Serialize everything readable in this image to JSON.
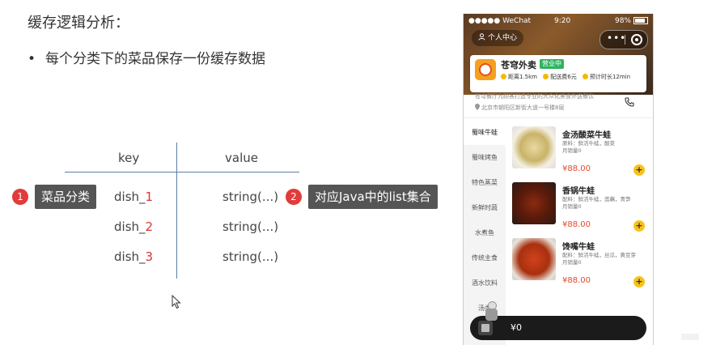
{
  "slide": {
    "title": "缓存逻辑分析：",
    "bullet": "每个分类下的菜品保存一份缓存数据",
    "bullet_marker": "•"
  },
  "table": {
    "headers": {
      "key": "key",
      "value": "value"
    },
    "rows": [
      {
        "key_prefix": "dish_",
        "key_num": "1",
        "value": "string(...)"
      },
      {
        "key_prefix": "dish_",
        "key_num": "2",
        "value": "string(...)"
      },
      {
        "key_prefix": "dish_",
        "key_num": "3",
        "value": "string(...)"
      }
    ]
  },
  "annotations": [
    {
      "badge": "1",
      "label": "菜品分类"
    },
    {
      "badge": "2",
      "label": "对应Java中的list集合"
    }
  ],
  "phone": {
    "status": {
      "carrier": "●●●●● WeChat",
      "time": "9:20",
      "battery": "98%"
    },
    "user_center": "个人中心",
    "shop": {
      "name": "苍穹外卖",
      "open_badge": "营业中",
      "distance": "距离1.5km",
      "delivery_fee": "配送费6元",
      "eta": "预计时长12min",
      "description": "苍穹餐厅为顾客打造专业的大众化美食外送餐饮",
      "address": "北京市朝阳区新街大道一号楼8层"
    },
    "categories": [
      "蜀味牛蛙",
      "蜀味烤鱼",
      "特色蒸菜",
      "新鲜时蔬",
      "水煮鱼",
      "传统主食",
      "酒水饮料",
      "汤类"
    ],
    "active_category": "蜀味牛蛙",
    "dishes": [
      {
        "name": "金汤酸菜牛蛙",
        "ingredients": "原料：鲜活牛蛙，酸菜",
        "sales": "月销量0",
        "price": "¥88.00"
      },
      {
        "name": "香锅牛蛙",
        "ingredients": "配料：鲜活牛蛙，莲藕，青笋",
        "sales": "月销量0",
        "price": "¥88.00"
      },
      {
        "name": "馋嘴牛蛙",
        "ingredients": "配料：鲜活牛蛙，丝瓜，黄豆芽",
        "sales": "月销量0",
        "price": "¥88.00"
      }
    ],
    "cart_total": "¥0"
  },
  "colors": {
    "accent_red": "#e23b3b",
    "price": "#e6492c",
    "add_button": "#f7c31a",
    "divider": "#5b7fa6"
  }
}
